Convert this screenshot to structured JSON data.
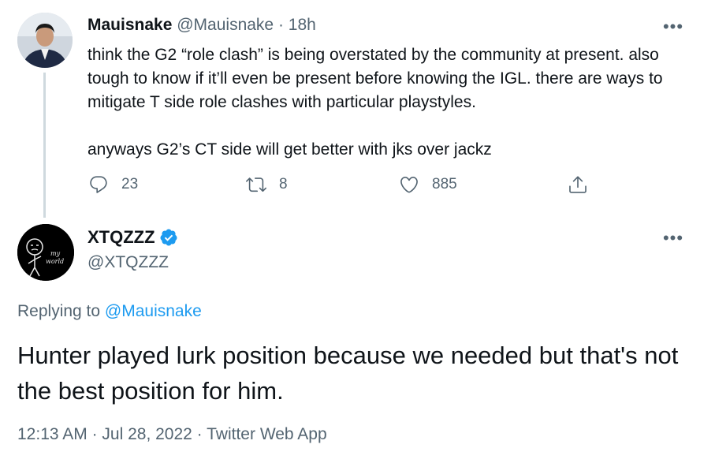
{
  "parent_tweet": {
    "display_name": "Mauisnake",
    "handle": "@Mauisnake",
    "separator": " · ",
    "time_ago": "18h",
    "text_paragraph_1": "think the G2 “role clash” is being overstated by the community at present. also tough to know if it’ll even be present before knowing the IGL. there are ways to mitigate T side role clashes with particular playstyles.",
    "text_paragraph_2": "anyways G2’s CT side will get better with jks over jackz",
    "reply_count": "23",
    "retweet_count": "8",
    "like_count": "885",
    "more_label": "•••"
  },
  "main_tweet": {
    "display_name": "XTQZZZ",
    "handle": "@XTQZZZ",
    "verified": true,
    "avatar_text_line1": "my",
    "avatar_text_line2": "world",
    "replying_prefix": "Replying to ",
    "replying_to": "@Mauisnake",
    "text": "Hunter played lurk position because we needed but that's not the best position for him.",
    "time": "12:13 AM",
    "date": "Jul 28, 2022",
    "source": "Twitter Web App",
    "separator": " · ",
    "more_label": "•••"
  },
  "colors": {
    "text_primary": "#0f1419",
    "text_secondary": "#536471",
    "accent_blue": "#1d9bf0",
    "thread_line": "#cfd9de"
  },
  "icons": [
    "reply-icon",
    "retweet-icon",
    "like-icon",
    "share-icon",
    "verified-badge-icon",
    "more-icon"
  ]
}
